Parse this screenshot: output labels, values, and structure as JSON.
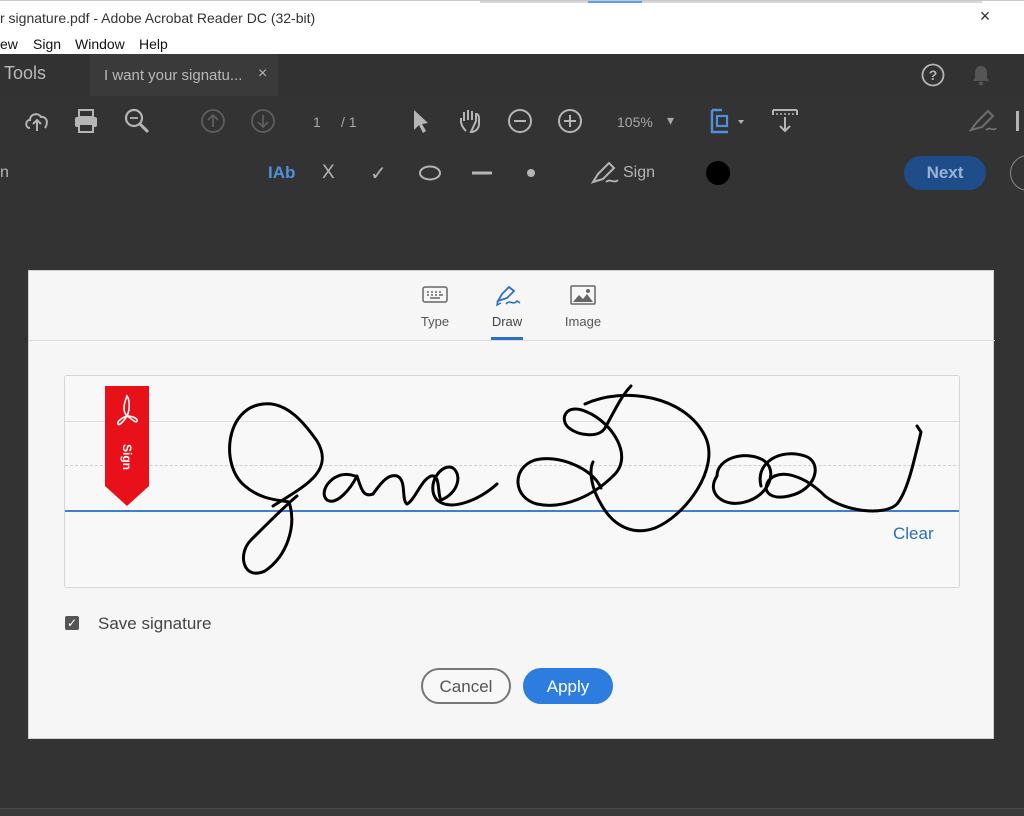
{
  "window": {
    "title": "r signature.pdf - Adobe Acrobat Reader DC (32-bit)",
    "close_glyph": "×"
  },
  "menu": {
    "items": [
      "ew",
      "Sign",
      "Window",
      "Help"
    ]
  },
  "tabs": {
    "tools": "Tools",
    "document": "I want your signatu...",
    "close_glyph": "×"
  },
  "toolbar": {
    "page_current": "1",
    "page_total": "/ 1",
    "zoom": "105%",
    "zoom_caret": "▾"
  },
  "signbar": {
    "left_fragment": "n",
    "text_tool": "IAb",
    "cross_tool": "X",
    "check_tool": "✓",
    "sign_label": "Sign",
    "next_label": "Next"
  },
  "dialog": {
    "tabs": [
      {
        "label": "Type",
        "icon": "keyboard-icon",
        "active": false
      },
      {
        "label": "Draw",
        "icon": "pen-draw-icon",
        "active": true
      },
      {
        "label": "Image",
        "icon": "image-icon",
        "active": false
      }
    ],
    "ribbon_label": "Sign",
    "clear_label": "Clear",
    "save_signature_label": "Save signature",
    "save_signature_checked": true,
    "cancel_label": "Cancel",
    "apply_label": "Apply"
  },
  "colors": {
    "accent": "#2d7de0",
    "ribbon": "#e8111a",
    "next_button": "#1e4d8a"
  }
}
